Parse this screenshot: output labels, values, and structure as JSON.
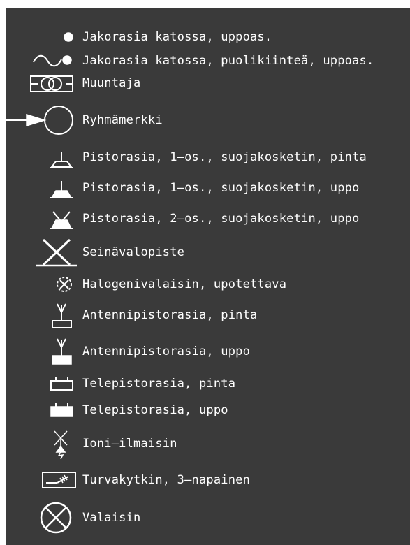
{
  "legend": {
    "items": [
      {
        "icon": "ceiling-junction-box-icon",
        "label": "Jakorasia katossa, uppoas."
      },
      {
        "icon": "ceiling-junction-box-semi-fixed-icon",
        "label": "Jakorasia katossa, puolikiinteä, uppoas."
      },
      {
        "icon": "transformer-icon",
        "label": "Muuntaja"
      },
      {
        "icon": "group-mark-icon",
        "label": "Ryhmämerkki"
      },
      {
        "icon": "socket-earthed-surface-icon",
        "label": "Pistorasia, 1–os., suojakosketin, pinta"
      },
      {
        "icon": "socket-earthed-flush-icon",
        "label": "Pistorasia, 1–os., suojakosketin, uppo"
      },
      {
        "icon": "double-socket-earthed-flush-icon",
        "label": "Pistorasia, 2–os., suojakosketin, uppo"
      },
      {
        "icon": "wall-light-point-icon",
        "label": "Seinävalopiste"
      },
      {
        "icon": "recessed-halogen-light-icon",
        "label": "Halogenivalaisin, upotettava"
      },
      {
        "icon": "antenna-socket-surface-icon",
        "label": "Antennipistorasia, pinta"
      },
      {
        "icon": "antenna-socket-flush-icon",
        "label": "Antennipistorasia, uppo"
      },
      {
        "icon": "telephone-socket-surface-icon",
        "label": "Telepistorasia, pinta"
      },
      {
        "icon": "telephone-socket-flush-icon",
        "label": "Telepistorasia, uppo"
      },
      {
        "icon": "ion-smoke-detector-icon",
        "label": "Ioni–ilmaisin"
      },
      {
        "icon": "safety-switch-3-pole-icon",
        "label": "Turvakytkin, 3–napainen"
      },
      {
        "icon": "luminaire-icon",
        "label": "Valaisin"
      }
    ]
  }
}
